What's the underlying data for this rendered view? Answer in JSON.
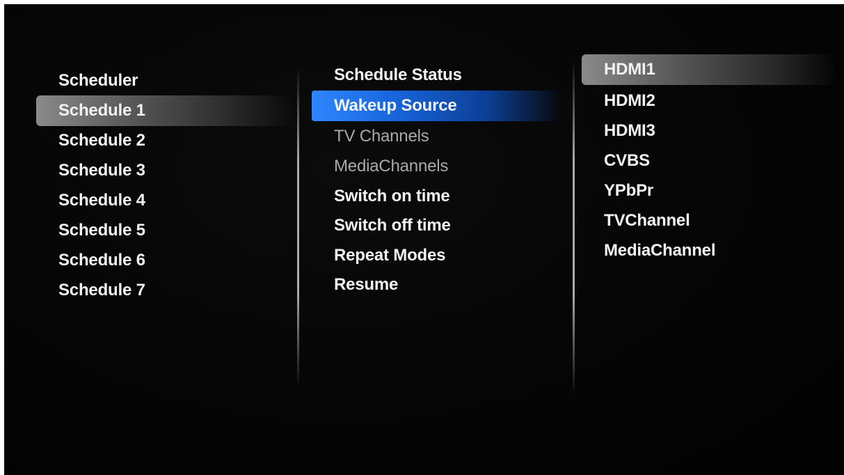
{
  "left_column": {
    "header": "Scheduler",
    "items": [
      "Schedule 1",
      "Schedule 2",
      "Schedule 3",
      "Schedule 4",
      "Schedule 5",
      "Schedule 6",
      "Schedule 7"
    ],
    "selected_index": 0
  },
  "middle_column": {
    "header": "Schedule Status",
    "items": [
      {
        "label": "Wakeup Source",
        "state": "focused"
      },
      {
        "label": "TV Channels",
        "state": "disabled"
      },
      {
        "label": "MediaChannels",
        "state": "disabled"
      },
      {
        "label": "Switch on time",
        "state": "normal"
      },
      {
        "label": "Switch off time",
        "state": "normal"
      },
      {
        "label": "Repeat Modes",
        "state": "normal"
      },
      {
        "label": "Resume",
        "state": "normal"
      }
    ]
  },
  "right_column": {
    "items": [
      "HDMI1",
      "HDMI2",
      "HDMI3",
      "CVBS",
      "YPbPr",
      "TVChannel",
      "MediaChannel"
    ],
    "selected_index": 0
  },
  "colors": {
    "focus_blue": "#1f74ee",
    "selection_grey": "#7a7a7a",
    "text": "#f2f2f2",
    "text_disabled": "#a9a9a9",
    "background": "#050505"
  }
}
